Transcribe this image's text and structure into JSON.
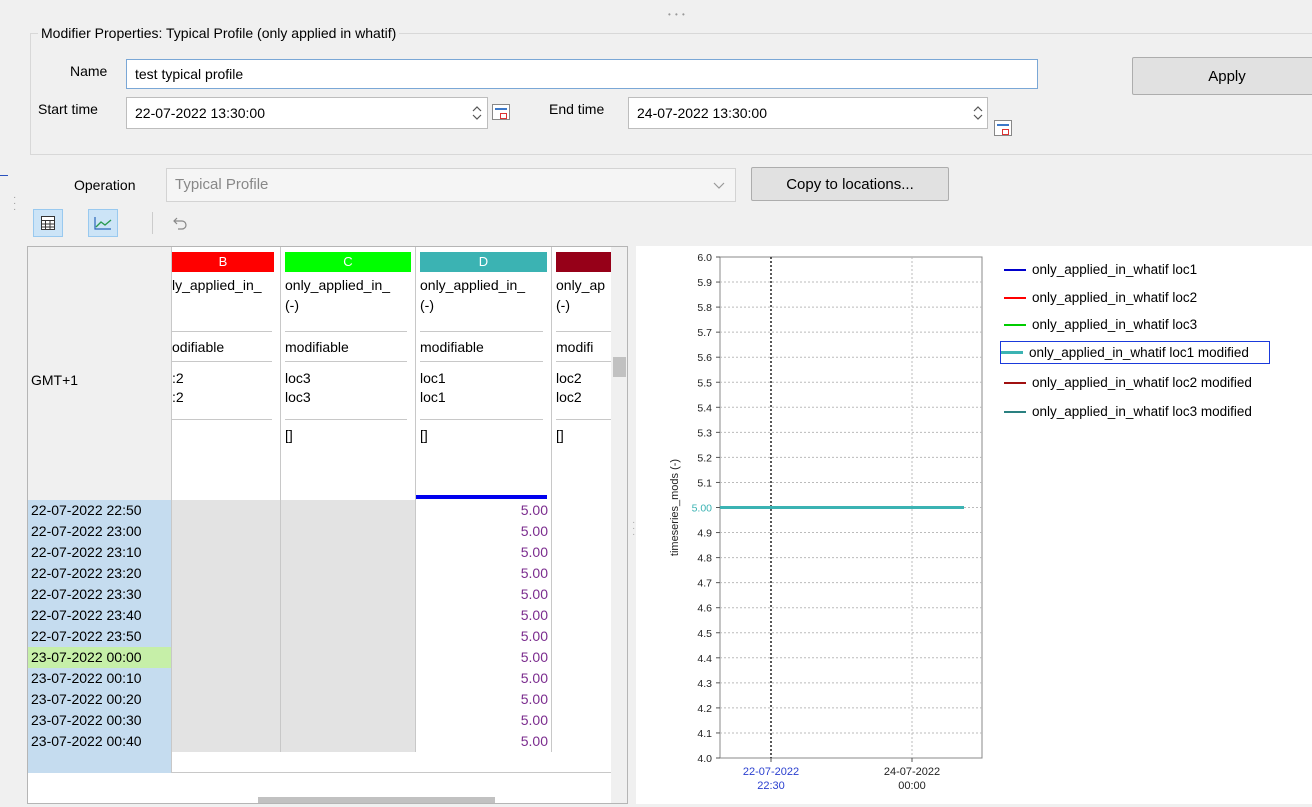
{
  "group_title": "Modifier Properties: Typical Profile (only applied in whatif)",
  "name_label": "Name",
  "name_value": "test typical profile",
  "start_label": "Start time",
  "start_value": "22-07-2022 13:30:00",
  "end_label": "End time",
  "end_value": "24-07-2022 13:30:00",
  "apply_label": "Apply",
  "operation_label": "Operation",
  "operation_value": "Typical Profile",
  "copy_label": "Copy to locations...",
  "corner_label": "GMT+1",
  "colors": {
    "B": "#ff0000",
    "C": "#00ff00",
    "D": "#3bb3b3",
    "E": "#960018"
  },
  "columns": [
    {
      "caption": "B",
      "name": "ly_applied_in_",
      "unit": "",
      "mod": "odifiable",
      "loc1": ":2",
      "loc2": ":2",
      "extra": ""
    },
    {
      "caption": "C",
      "name": "only_applied_in_",
      "unit": "(-)",
      "mod": "modifiable",
      "loc1": "loc3",
      "loc2": "loc3",
      "extra": "[]"
    },
    {
      "caption": "D",
      "name": "only_applied_in_",
      "unit": "(-)",
      "mod": "modifiable",
      "loc1": "loc1",
      "loc2": "loc1",
      "extra": "[]"
    },
    {
      "caption": "",
      "name": "only_ap",
      "unit": "(-)",
      "mod": "modifi",
      "loc1": "loc2",
      "loc2": "loc2",
      "extra": "[]"
    }
  ],
  "rows": [
    {
      "time": "22-07-2022 22:50",
      "d": "5.00"
    },
    {
      "time": "22-07-2022 23:00",
      "d": "5.00"
    },
    {
      "time": "22-07-2022 23:10",
      "d": "5.00"
    },
    {
      "time": "22-07-2022 23:20",
      "d": "5.00"
    },
    {
      "time": "22-07-2022 23:30",
      "d": "5.00"
    },
    {
      "time": "22-07-2022 23:40",
      "d": "5.00"
    },
    {
      "time": "22-07-2022 23:50",
      "d": "5.00"
    },
    {
      "time": "23-07-2022 00:00",
      "d": "5.00"
    },
    {
      "time": "23-07-2022 00:10",
      "d": "5.00"
    },
    {
      "time": "23-07-2022 00:20",
      "d": "5.00"
    },
    {
      "time": "23-07-2022 00:30",
      "d": "5.00"
    },
    {
      "time": "23-07-2022 00:40",
      "d": "5.00"
    }
  ],
  "chart_data": {
    "type": "line",
    "ylabel": "timeseries_mods (-)",
    "ylim": [
      4.0,
      6.0
    ],
    "yticks": [
      "6.0",
      "5.9",
      "5.8",
      "5.7",
      "5.6",
      "5.5",
      "5.4",
      "5.3",
      "5.2",
      "5.1",
      "5.00",
      "4.9",
      "4.8",
      "4.7",
      "4.6",
      "4.5",
      "4.4",
      "4.3",
      "4.2",
      "4.1",
      "4.0"
    ],
    "xticks": [
      {
        "date": "22-07-2022",
        "time": "22:30"
      },
      {
        "date": "24-07-2022",
        "time": "00:00"
      }
    ],
    "grid": true,
    "legend_position": "right",
    "series": [
      {
        "name": "only_applied_in_whatif loc1",
        "color": "#0000cc",
        "values": []
      },
      {
        "name": "only_applied_in_whatif loc2",
        "color": "#ff0000",
        "values": []
      },
      {
        "name": "only_applied_in_whatif loc3",
        "color": "#00cc00",
        "values": []
      },
      {
        "name": "only_applied_in_whatif loc1 modified",
        "color": "#3bb3b3",
        "values": [
          5.0,
          5.0
        ]
      },
      {
        "name": "only_applied_in_whatif loc2 modified",
        "color": "#a01010",
        "values": []
      },
      {
        "name": "only_applied_in_whatif loc3 modified",
        "color": "#2a8080",
        "values": []
      }
    ]
  }
}
